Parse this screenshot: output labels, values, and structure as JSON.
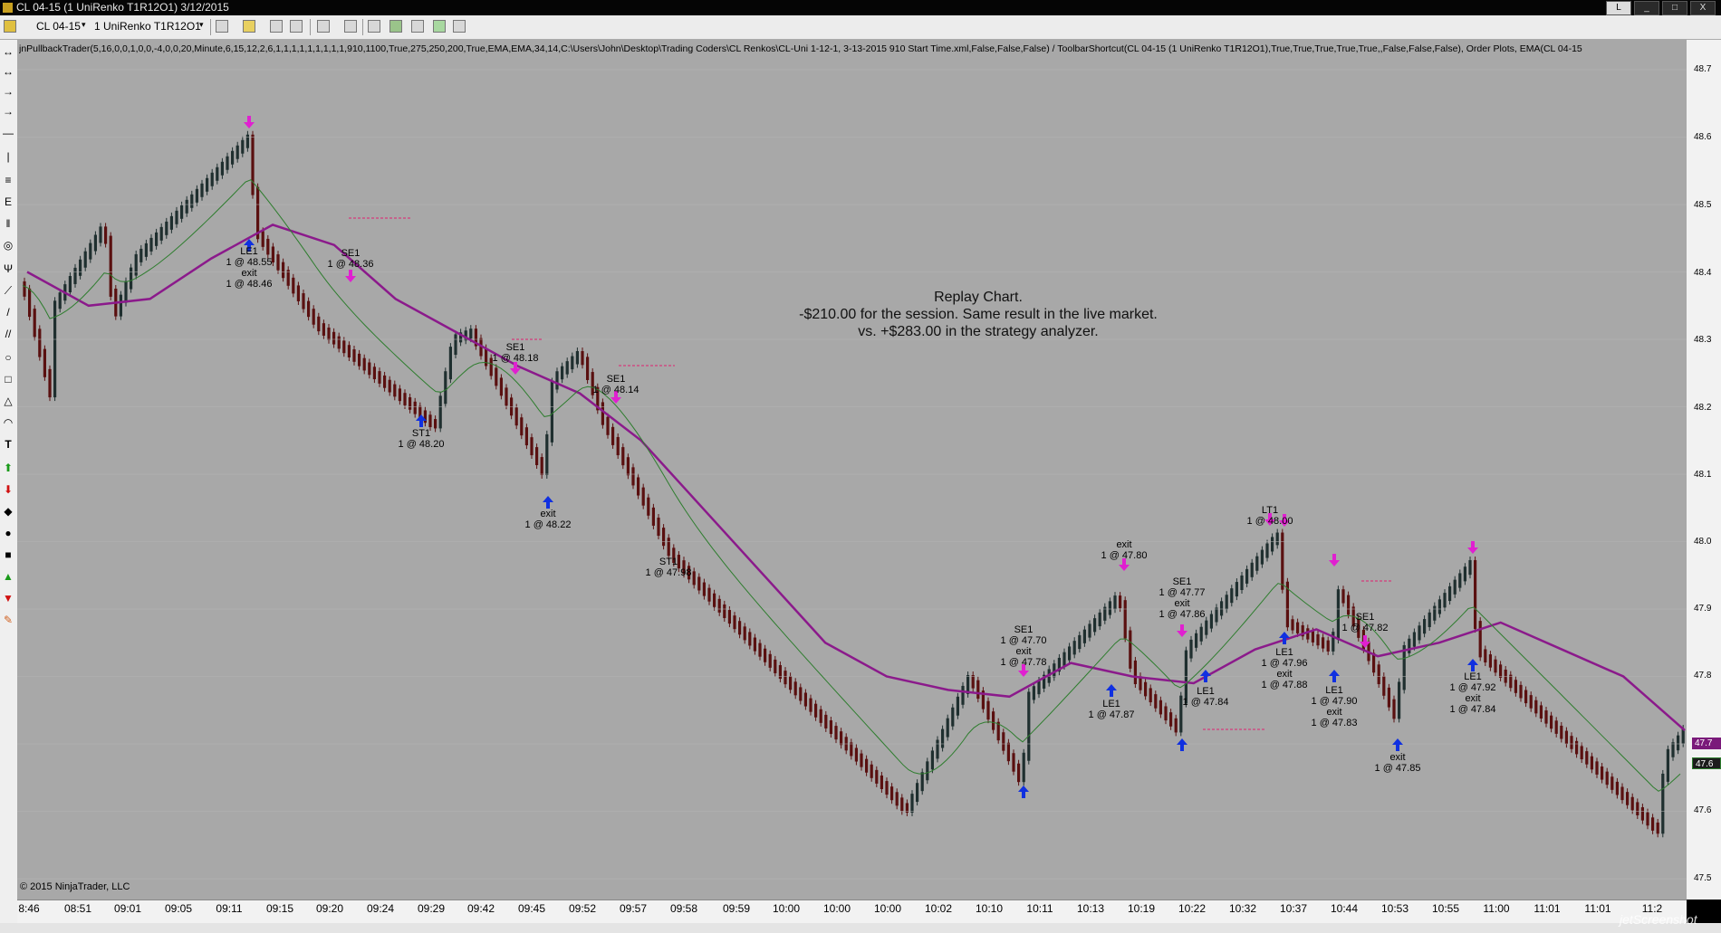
{
  "window": {
    "title": "CL 04-15 (1 UniRenko T1R12O1)  3/12/2015",
    "buttons": [
      "L",
      "_",
      "□",
      "X"
    ]
  },
  "toolbar": {
    "instrument": "CL 04-15",
    "bar_type": "1 UniRenko T1R12O1"
  },
  "chart": {
    "params": "jnPullbackTrader(5,16,0,0,1,0,0,-4,0,0,20,Minute,6,15,12,2,6,1,1,1,1,1,1,1,1,1,910,1100,True,275,250,200,True,EMA,EMA,34,14,C:\\Users\\John\\Desktop\\Trading Coders\\CL Renkos\\CL-Uni 1-12-1, 3-13-2015 910 Start Time.xml,False,False,False) / ToolbarShortcut(CL 04-15 (1 UniRenko T1R12O1),True,True,True,True,True,,False,False,False), Order Plots, EMA(CL 04-15",
    "copyright": "© 2015 NinjaTrader, LLC",
    "notes": [
      "Replay Chart.",
      "-$210.00 for the session. Same result in the live market.",
      "vs. +$283.00 in the strategy analyzer."
    ],
    "price_labels": [
      "48.7",
      "48.6",
      "48.5",
      "48.4",
      "48.3",
      "48.2",
      "48.1",
      "48.0",
      "47.9",
      "47.8",
      "47.7",
      "47.6",
      "47.5"
    ],
    "price_badges": [
      "47.7",
      "47.6"
    ],
    "time_labels": [
      "8:46",
      "08:51",
      "09:01",
      "09:05",
      "09:11",
      "09:15",
      "09:20",
      "09:24",
      "09:29",
      "09:42",
      "09:45",
      "09:52",
      "09:57",
      "09:58",
      "09:59",
      "10:00",
      "10:00",
      "10:00",
      "10:02",
      "10:10",
      "10:11",
      "10:13",
      "10:19",
      "10:22",
      "10:32",
      "10:37",
      "10:44",
      "10:53",
      "10:55",
      "11:00",
      "11:01",
      "11:01",
      "11:2"
    ],
    "trade_labels": [
      {
        "name": "le1-48-55",
        "lines": [
          "LE1",
          "1 @ 48.55",
          "exit",
          "1 @ 48.46"
        ]
      },
      {
        "name": "se1-48-36",
        "lines": [
          "SE1",
          "1 @ 48.36"
        ]
      },
      {
        "name": "st1-48-20",
        "lines": [
          "ST1",
          "1 @ 48.20"
        ]
      },
      {
        "name": "se1-48-18",
        "lines": [
          "SE1",
          "1 @ 48.18"
        ]
      },
      {
        "name": "exit-48-22",
        "lines": [
          "exit",
          "1 @ 48.22"
        ]
      },
      {
        "name": "se1-48-14",
        "lines": [
          "SE1",
          "1 @ 48.14"
        ]
      },
      {
        "name": "st1-47-98",
        "lines": [
          "ST1",
          "1 @ 47.98"
        ]
      },
      {
        "name": "se1-47-70",
        "lines": [
          "SE1",
          "1 @ 47.70",
          "exit",
          "1 @ 47.78"
        ]
      },
      {
        "name": "le1-47-87",
        "lines": [
          "LE1",
          "1 @ 47.87"
        ]
      },
      {
        "name": "exit-47-80",
        "lines": [
          "exit",
          "1 @ 47.80"
        ]
      },
      {
        "name": "se1-47-77",
        "lines": [
          "SE1",
          "1 @ 47.77",
          "exit",
          "1 @ 47.86"
        ]
      },
      {
        "name": "le1-47-84",
        "lines": [
          "LE1",
          "1 @ 47.84"
        ]
      },
      {
        "name": "lt1-48-00",
        "lines": [
          "LT1",
          "1 @ 48.00"
        ]
      },
      {
        "name": "le1-47-96",
        "lines": [
          "LE1",
          "1 @ 47.96",
          "exit",
          "1 @ 47.88"
        ]
      },
      {
        "name": "le1-47-90",
        "lines": [
          "LE1",
          "1 @ 47.90",
          "exit",
          "1 @ 47.83"
        ]
      },
      {
        "name": "se1-47-82",
        "lines": [
          "SE1",
          "1 @ 47.82"
        ]
      },
      {
        "name": "exit-47-85",
        "lines": [
          "exit",
          "1 @ 47.85"
        ]
      },
      {
        "name": "le1-47-92",
        "lines": [
          "LE1",
          "1 @ 47.92",
          "exit",
          "1 @ 47.84"
        ]
      }
    ],
    "colors": {
      "background": "#a8a8a8",
      "ema_slow": "#8b1a8b",
      "ema_fast": "#2e7d2e",
      "up_bar": "#1f2f2f",
      "down_bar": "#5a1010",
      "buy_arrow": "#1030e0",
      "sell_arrow": "#e020d0"
    }
  },
  "chart_data": {
    "type": "line",
    "title": "",
    "series": [
      {
        "name": "",
        "values": [
          48.4,
          48.35,
          48.36,
          48.42,
          48.47,
          48.44,
          48.36,
          48.31,
          48.26,
          48.22,
          48.15,
          48.05,
          47.95,
          47.85,
          47.8,
          47.78,
          47.77,
          47.82,
          47.8,
          47.79,
          47.84,
          47.87,
          47.83,
          47.85,
          47.88,
          47.84,
          47.8,
          47.72
        ]
      }
    ],
    "ylim": [
      47.5,
      48.7
    ]
  },
  "watermark": "jetScreenshot"
}
